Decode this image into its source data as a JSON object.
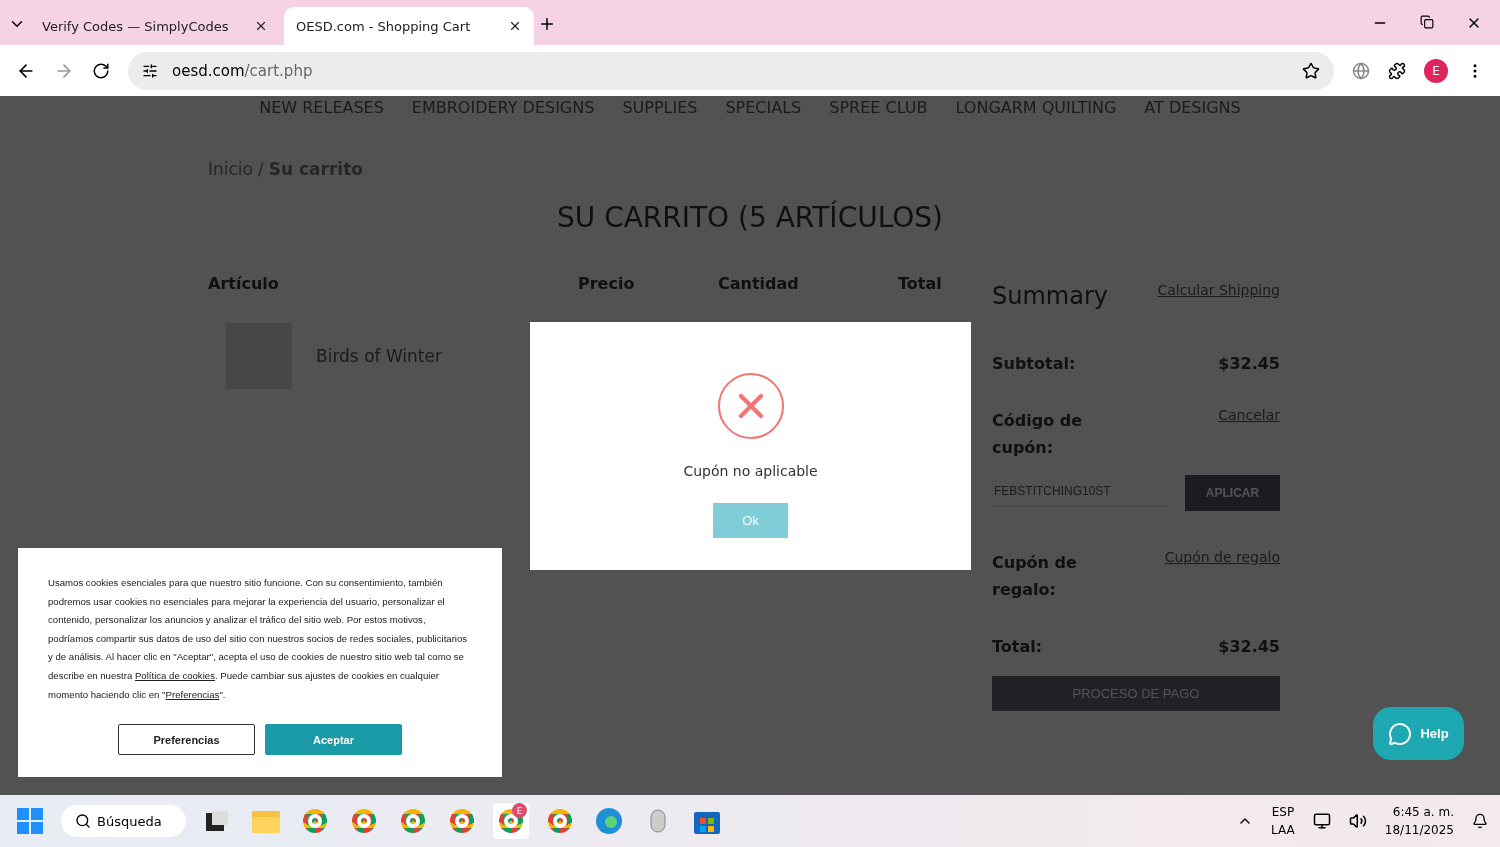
{
  "browser": {
    "tabs": [
      {
        "title": "Verify Codes — SimplyCodes",
        "selected": false
      },
      {
        "title": "OESD.com - Shopping Cart",
        "selected": true
      }
    ],
    "url_host": "oesd.com",
    "url_path": "/cart.php",
    "profile_initial": "E"
  },
  "page": {
    "nav": [
      "NEW RELEASES",
      "EMBROIDERY DESIGNS",
      "SUPPLIES",
      "SPECIALS",
      "SPREE CLUB",
      "LONGARM QUILTING",
      "AT DESIGNS"
    ],
    "breadcrumb_separator": "/",
    "breadcrumb": [
      {
        "label": "Inicio",
        "current": false
      },
      {
        "label": "Su carrito",
        "current": true
      }
    ],
    "title": "SU CARRITO (5 ARTÍCULOS)",
    "columns": [
      "Artículo",
      "Precio",
      "Cantidad",
      "Total"
    ],
    "items": [
      {
        "name": "Birds of Winter"
      }
    ],
    "summary": {
      "title": "Summary",
      "shipping_link": "Calcular Shipping",
      "subtotal_label": "Subtotal:",
      "subtotal": "$32.45",
      "coupon_label": "Código de cupón:",
      "coupon_cancel": "Cancelar",
      "coupon_value": "FEBSTITCHING10ST",
      "apply": "APLICAR",
      "gift_label": "Cupón de regalo:",
      "gift_link": "Cupón de regalo",
      "total_label": "Total:",
      "total": "$32.45",
      "checkout": "PROCESO DE PAGO"
    }
  },
  "modal": {
    "message": "Cupón no aplicable",
    "button": "Ok"
  },
  "cookie_banner": {
    "text_before": "Usamos cookies esenciales para que nuestro sitio funcione. Con su consentimiento, también podremos usar cookies no esenciales para mejorar la experiencia del usuario, personalizar el contenido, personalizar los anuncios y analizar el tráfico del sitio web. Por estos motivos, podríamos compartir sus datos de uso del sitio con nuestros socios de redes sociales, publicitarios y de análisis. Al hacer clic en \"Aceptar\", acepta el uso de cookies de nuestro sitio web tal como se describe en nuestra ",
    "policy_link": "Política de cookies",
    "text_middle": ". Puede cambiar sus ajustes de cookies en cualquier momento haciendo clic en \"",
    "prefs_link": "Preferencias",
    "text_after": "\".",
    "buttons": [
      {
        "label": "Preferencias",
        "kind": "outline"
      },
      {
        "label": "Aceptar",
        "kind": "primary"
      }
    ]
  },
  "help": "Help",
  "taskbar": {
    "search": "Búsqueda",
    "apps": [
      {
        "kind": "start"
      },
      {
        "kind": "view"
      },
      {
        "kind": "folder"
      },
      {
        "kind": "chrome",
        "selected": false
      },
      {
        "kind": "chrome",
        "selected": false
      },
      {
        "kind": "chrome",
        "selected": false
      },
      {
        "kind": "chrome",
        "selected": false
      },
      {
        "kind": "chrome",
        "selected": true
      },
      {
        "kind": "chrome",
        "selected": false
      },
      {
        "kind": "edge"
      },
      {
        "kind": "mouse"
      },
      {
        "kind": "store"
      }
    ],
    "active_badge": "E",
    "lang": [
      "ESP",
      "LAA"
    ],
    "time": "6:45 a. m.",
    "date": "18/11/2025"
  }
}
